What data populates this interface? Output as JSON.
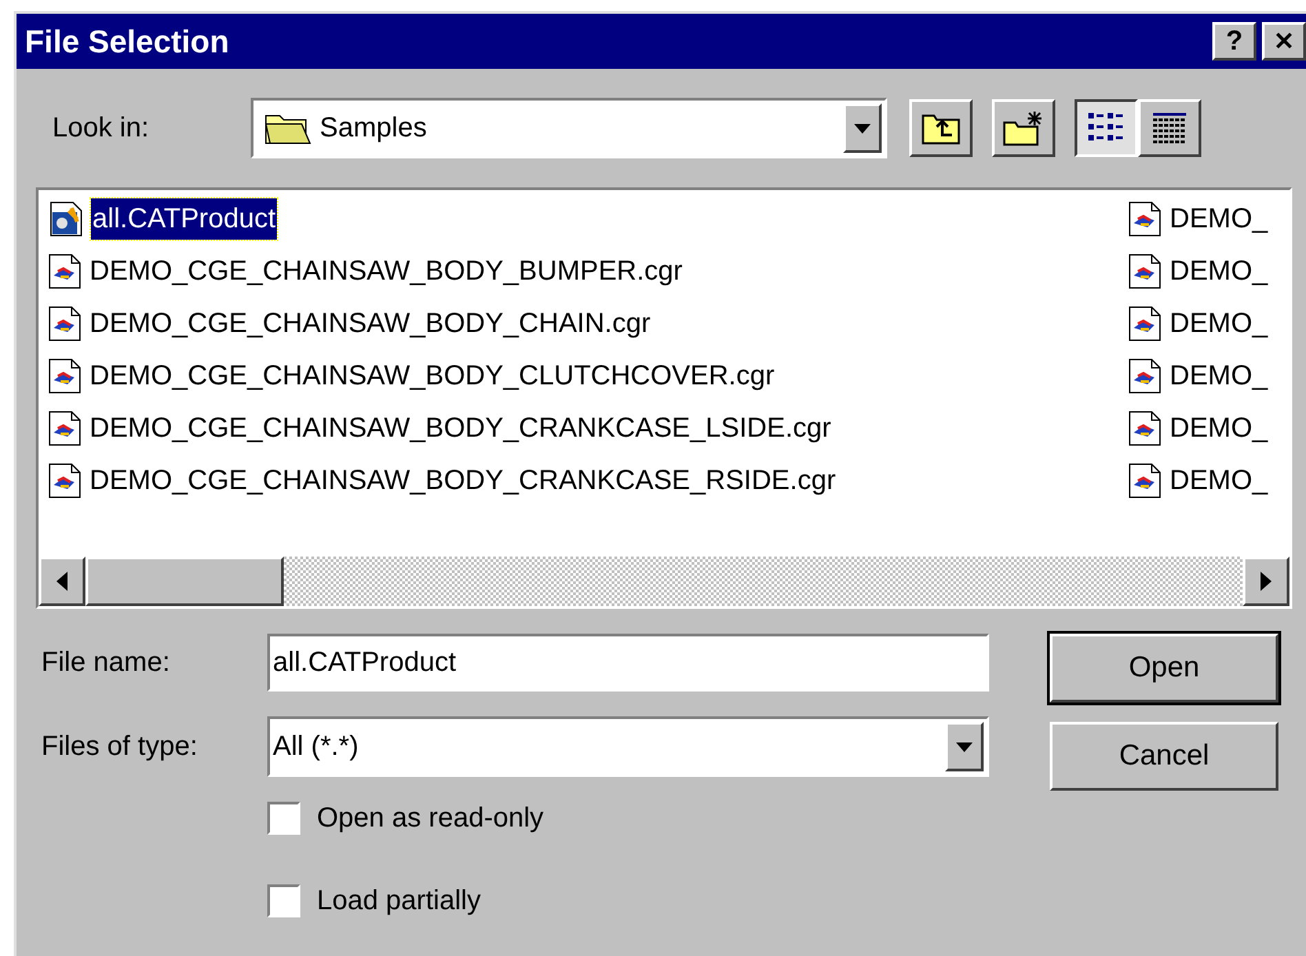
{
  "window": {
    "title": "File Selection",
    "help_button": "?",
    "close_button": "✕"
  },
  "look_in": {
    "label": "Look in:",
    "value": "Samples"
  },
  "toolbar": [
    {
      "kind": "up"
    },
    {
      "kind": "new_folder"
    },
    {
      "kind": "list",
      "selected": true
    },
    {
      "kind": "details",
      "selected": false
    }
  ],
  "files": {
    "columns": [
      [
        {
          "name": "all.CATProduct",
          "kind": "product",
          "selected": true
        },
        {
          "name": "DEMO_CGE_CHAINSAW_BODY_BUMPER.cgr",
          "kind": "cgr",
          "selected": false
        },
        {
          "name": "DEMO_CGE_CHAINSAW_BODY_CHAIN.cgr",
          "kind": "cgr",
          "selected": false
        },
        {
          "name": "DEMO_CGE_CHAINSAW_BODY_CLUTCHCOVER.cgr",
          "kind": "cgr",
          "selected": false
        },
        {
          "name": "DEMO_CGE_CHAINSAW_BODY_CRANKCASE_LSIDE.cgr",
          "kind": "cgr",
          "selected": false
        },
        {
          "name": "DEMO_CGE_CHAINSAW_BODY_CRANKCASE_RSIDE.cgr",
          "kind": "cgr",
          "selected": false
        }
      ],
      [
        {
          "name": "DEMO_",
          "kind": "cgr",
          "selected": false
        },
        {
          "name": "DEMO_",
          "kind": "cgr",
          "selected": false
        },
        {
          "name": "DEMO_",
          "kind": "cgr",
          "selected": false
        },
        {
          "name": "DEMO_",
          "kind": "cgr",
          "selected": false
        },
        {
          "name": "DEMO_",
          "kind": "cgr",
          "selected": false
        },
        {
          "name": "DEMO_",
          "kind": "cgr",
          "selected": false
        }
      ]
    ]
  },
  "file_name": {
    "label": "File name:",
    "value": "all.CATProduct"
  },
  "file_type": {
    "label": "Files of type:",
    "value": "All (*.*)"
  },
  "buttons": [
    {
      "label": "Open",
      "default": true
    },
    {
      "label": "Cancel",
      "default": false
    }
  ],
  "options": [
    {
      "label": "Open as read-only",
      "checked": false
    },
    {
      "label": "Load partially",
      "checked": false
    }
  ]
}
